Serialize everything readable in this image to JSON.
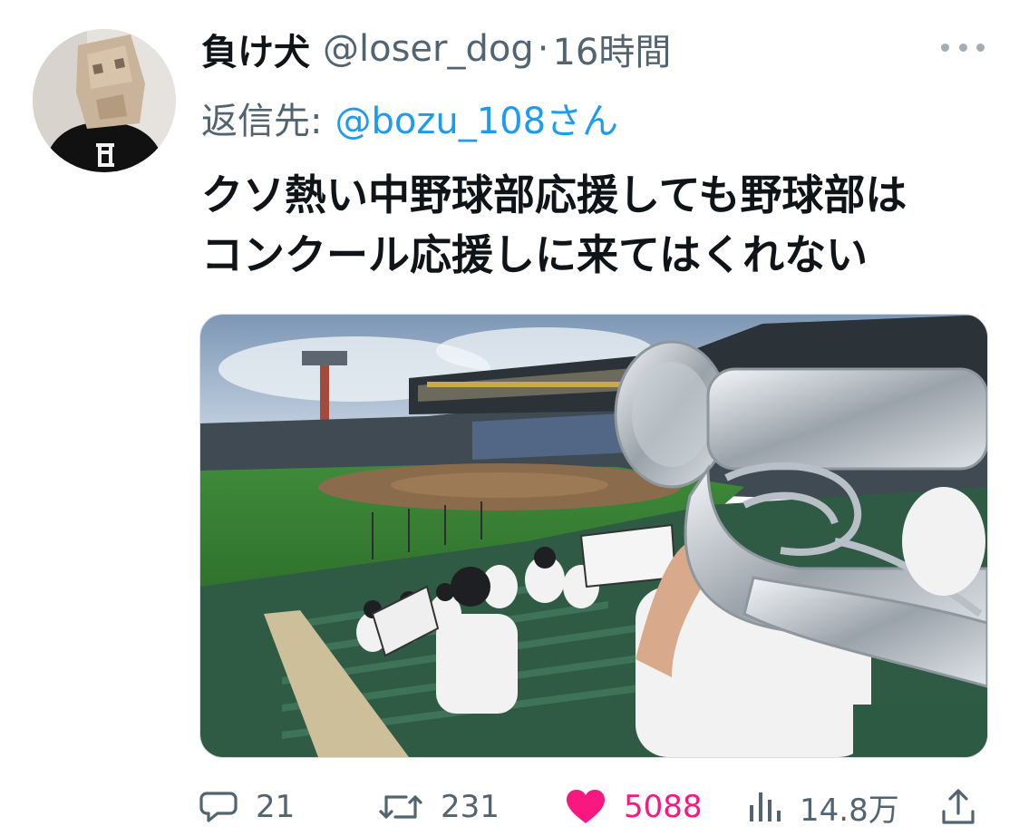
{
  "tweet": {
    "author_name": "負け犬",
    "author_handle": "@loser_dog",
    "separator": "·",
    "time": "16時間",
    "reply_to_label": "返信先:",
    "reply_to_handle": "@bozu_108さん",
    "text_lines": [
      "クソ熱い中野球部応援しても野球部は",
      "コンクール応援しに来てはくれない"
    ]
  },
  "actions": {
    "reply_count": "21",
    "retweet_count": "231",
    "like_count": "5088",
    "views_count": "14.8万"
  },
  "icons": {
    "more": "more-dots-icon",
    "reply": "reply-bubble-icon",
    "retweet": "retweet-icon",
    "like": "heart-icon",
    "views": "bar-chart-icon",
    "share": "share-icon"
  },
  "colors": {
    "text": "#0f1419",
    "secondary": "#536471",
    "link": "#1d9bf0",
    "like": "#f91880"
  }
}
